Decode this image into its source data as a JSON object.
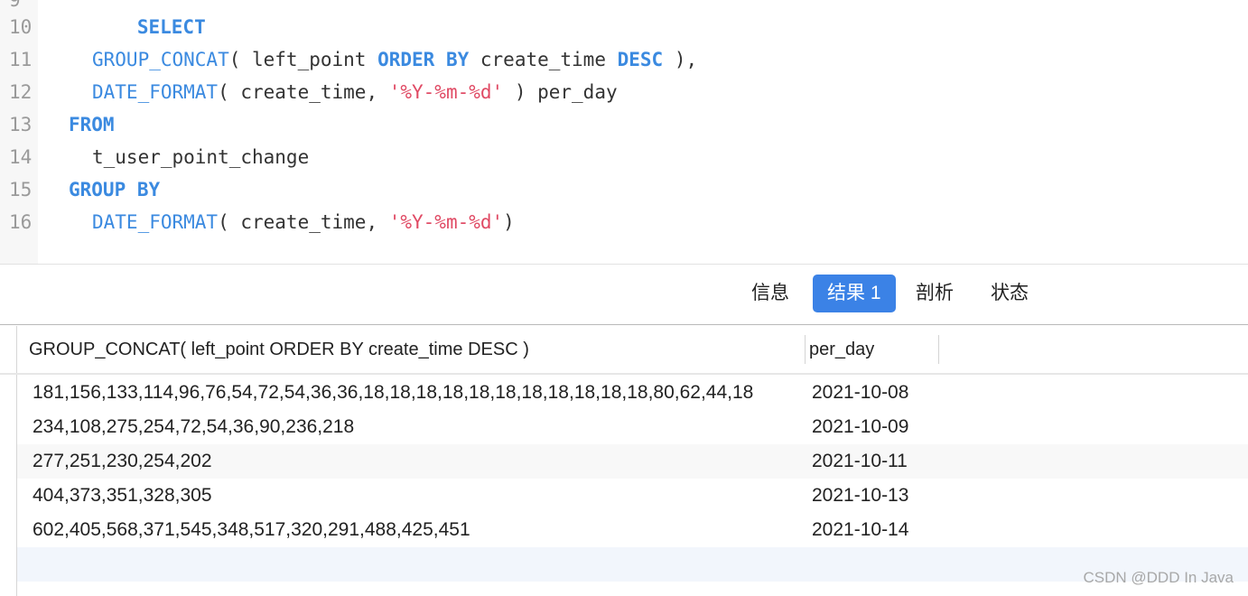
{
  "editor": {
    "partial_line_number": "9",
    "lines": [
      {
        "num": "10",
        "tokens": [
          {
            "t": "SELECT",
            "c": "kw"
          }
        ]
      },
      {
        "num": "11",
        "tokens": [
          {
            "t": "GROUP_CONCAT",
            "c": "fn"
          },
          {
            "t": "( left_point ",
            "c": ""
          },
          {
            "t": "ORDER BY",
            "c": "kw"
          },
          {
            "t": " create_time ",
            "c": ""
          },
          {
            "t": "DESC",
            "c": "kw"
          },
          {
            "t": " ),",
            "c": ""
          }
        ]
      },
      {
        "num": "12",
        "tokens": [
          {
            "t": "DATE_FORMAT",
            "c": "fn"
          },
          {
            "t": "( create_time, ",
            "c": ""
          },
          {
            "t": "'%Y-%m-%d'",
            "c": "str"
          },
          {
            "t": " ) per_day",
            "c": ""
          }
        ]
      },
      {
        "num": "13",
        "tokens": [
          {
            "t": "FROM",
            "c": "kw"
          }
        ]
      },
      {
        "num": "14",
        "tokens": [
          {
            "t": "t_user_point_change",
            "c": ""
          }
        ]
      },
      {
        "num": "15",
        "tokens": [
          {
            "t": "GROUP BY",
            "c": "kw"
          }
        ]
      },
      {
        "num": "16",
        "tokens": [
          {
            "t": "DATE_FORMAT",
            "c": "fn"
          },
          {
            "t": "( create_time, ",
            "c": ""
          },
          {
            "t": "'%Y-%m-%d'",
            "c": "str"
          },
          {
            "t": ")",
            "c": ""
          }
        ]
      }
    ]
  },
  "tabs": {
    "info": "信息",
    "result1": "结果 1",
    "profile": "剖析",
    "status": "状态"
  },
  "grid": {
    "columns": [
      "GROUP_CONCAT( left_point ORDER BY create_time DESC )",
      "per_day"
    ],
    "rows": [
      [
        "181,156,133,114,96,76,54,72,54,36,36,18,18,18,18,18,18,18,18,18,18,18,80,62,44,18",
        "2021-10-08"
      ],
      [
        "234,108,275,254,72,54,36,90,236,218",
        "2021-10-09"
      ],
      [
        "277,251,230,254,202",
        "2021-10-11"
      ],
      [
        "404,373,351,328,305",
        "2021-10-13"
      ],
      [
        "602,405,568,371,545,348,517,320,291,488,425,451",
        "2021-10-14"
      ]
    ]
  },
  "watermark": "CSDN @DDD In Java",
  "colors": {
    "keyword": "#3b8ae0",
    "string": "#e04a64",
    "active_tab": "#3b82e6"
  }
}
